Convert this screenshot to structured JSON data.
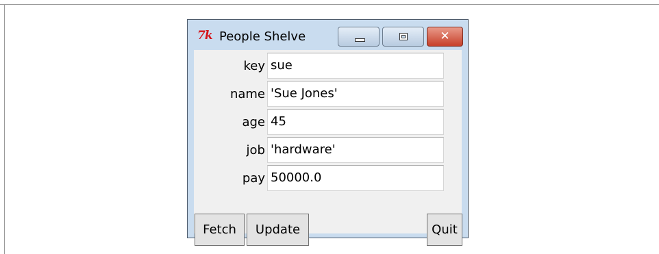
{
  "window": {
    "title": "People Shelve",
    "icon": "tk-icon"
  },
  "titlebar_buttons": {
    "minimize": "minimize-icon",
    "maximize": "maximize-icon",
    "close": "✕"
  },
  "fields": [
    {
      "label": "key",
      "value": "sue"
    },
    {
      "label": "name",
      "value": "'Sue Jones'"
    },
    {
      "label": "age",
      "value": "45"
    },
    {
      "label": "job",
      "value": "'hardware'"
    },
    {
      "label": "pay",
      "value": "50000.0"
    }
  ],
  "buttons": {
    "fetch": "Fetch",
    "update": "Update",
    "quit": "Quit"
  },
  "colors": {
    "titlebar": "#c9dcef",
    "close_button": "#c7402a",
    "client_background": "#f0f0f0"
  }
}
